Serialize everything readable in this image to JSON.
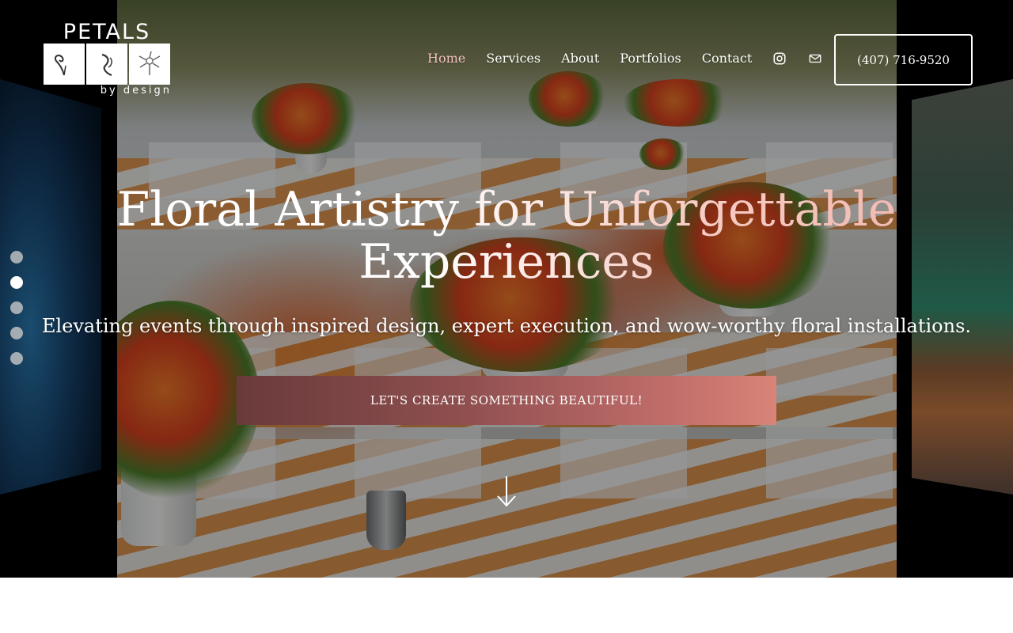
{
  "brand": {
    "name": "PETALS",
    "tagline": "by design"
  },
  "nav": {
    "items": [
      {
        "label": "Home",
        "active": true
      },
      {
        "label": "Services",
        "active": false
      },
      {
        "label": "About",
        "active": false
      },
      {
        "label": "Portfolios",
        "active": false
      },
      {
        "label": "Contact",
        "active": false
      }
    ],
    "icons": [
      "instagram-icon",
      "mail-icon"
    ]
  },
  "header": {
    "phone": "(407) 716-9520"
  },
  "hero": {
    "headline": "Floral Artistry for Unforgettable Experiences",
    "subheadline": "Elevating events through inspired design, expert execution, and wow-worthy floral installations.",
    "cta_label": "LET'S CREATE SOMETHING BEAUTIFUL!",
    "slides_total": 5,
    "active_slide": 2
  },
  "colors": {
    "accent": "#f6c3bc",
    "cta_start": "#6a3a3b",
    "cta_end": "#d98478"
  }
}
